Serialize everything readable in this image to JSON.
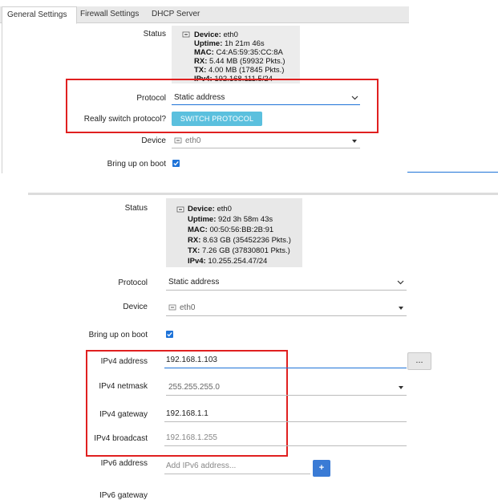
{
  "top": {
    "tabs": [
      "General Settings",
      "Firewall Settings",
      "DHCP Server"
    ],
    "status_label": "Status",
    "status": [
      {
        "k": "Device:",
        "v": " eth0"
      },
      {
        "k": "Uptime:",
        "v": " 1h 21m 46s"
      },
      {
        "k": "MAC:",
        "v": " C4:A5:59:35:CC:8A"
      },
      {
        "k": "RX:",
        "v": " 5.44 MB (59932 Pkts.)"
      },
      {
        "k": "TX:",
        "v": " 4.00 MB (17845 Pkts.)"
      },
      {
        "k": "IPv4:",
        "v": " 192.168.111.5/24"
      }
    ],
    "protocol_label": "Protocol",
    "protocol_value": "Static address",
    "really_switch_label": "Really switch protocol?",
    "switch_button": "SWITCH PROTOCOL",
    "device_label": "Device",
    "device_value": "eth0",
    "bring_up_label": "Bring up on boot",
    "bring_up_checked": true
  },
  "bottom": {
    "status_label": "Status",
    "status": [
      {
        "k": "Device:",
        "v": " eth0"
      },
      {
        "k": "Uptime:",
        "v": " 92d 3h 58m 43s"
      },
      {
        "k": "MAC:",
        "v": " 00:50:56:BB:2B:91"
      },
      {
        "k": "RX:",
        "v": " 8.63 GB (35452236 Pkts.)"
      },
      {
        "k": "TX:",
        "v": " 7.26 GB (37830801 Pkts.)"
      },
      {
        "k": "IPv4:",
        "v": " 10.255.254.47/24"
      }
    ],
    "protocol_label": "Protocol",
    "protocol_value": "Static address",
    "device_label": "Device",
    "device_value": "eth0",
    "bring_up_label": "Bring up on boot",
    "bring_up_checked": true,
    "ipv4_address_label": "IPv4 address",
    "ipv4_address_value": "192.168.1.103",
    "dots_button": "...",
    "ipv4_netmask_label": "IPv4 netmask",
    "ipv4_netmask_value": "255.255.255.0",
    "ipv4_gateway_label": "IPv4 gateway",
    "ipv4_gateway_value": "192.168.1.1",
    "ipv4_broadcast_label": "IPv4 broadcast",
    "ipv4_broadcast_placeholder": "192.168.1.255",
    "ipv6_address_label": "IPv6 address",
    "ipv6_address_placeholder": "Add IPv6 address...",
    "plus_button": "+",
    "ipv6_gateway_label": "IPv6 gateway"
  },
  "colors": {
    "highlight": "#e02020",
    "active_underline": "#1e73d8",
    "switch_button_bg": "#5bc0de",
    "plus_button_bg": "#3a7bd5",
    "status_bg": "#ececec"
  },
  "icons": [
    "network-port-icon",
    "chevron-down-icon",
    "caret-down-icon",
    "checkbox-checked-icon"
  ]
}
